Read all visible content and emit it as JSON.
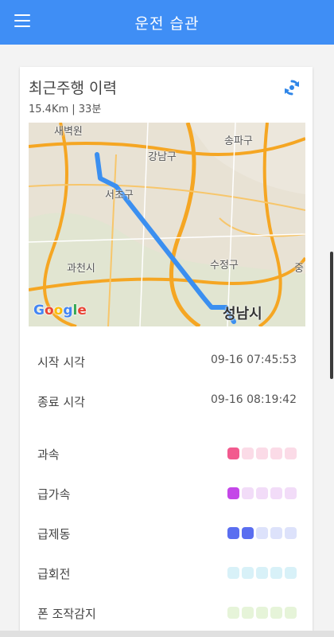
{
  "appbar": {
    "title": "운전 습관"
  },
  "trip": {
    "title": "최근주행 이력",
    "summary": "15.4Km | 33분",
    "map": {
      "labels": [
        "새벽원",
        "강남구",
        "송파구",
        "서초구",
        "과천시",
        "수정구",
        "중",
        "성남시"
      ],
      "attribution": "Google"
    },
    "start": {
      "label": "시작 시각",
      "value": "09-16 07:45:53"
    },
    "end": {
      "label": "종료 시각",
      "value": "09-16 08:19:42"
    }
  },
  "habits": [
    {
      "label": "과속",
      "level": 1,
      "active_color": "#f25a8e",
      "inactive_color": "#fbdbe7"
    },
    {
      "label": "급가속",
      "level": 1,
      "active_color": "#c447e8",
      "inactive_color": "#f2dcf8"
    },
    {
      "label": "급제동",
      "level": 2,
      "active_color": "#5a6ef0",
      "inactive_color": "#dde2fb"
    },
    {
      "label": "급회전",
      "level": 0,
      "active_color": "#4fc3e0",
      "inactive_color": "#d8f1f8"
    },
    {
      "label": "폰 조작감지",
      "level": 0,
      "active_color": "#8ccf5a",
      "inactive_color": "#e6f4d9"
    }
  ],
  "icons": {
    "menu": "menu-icon",
    "refresh": "refresh-icon"
  }
}
